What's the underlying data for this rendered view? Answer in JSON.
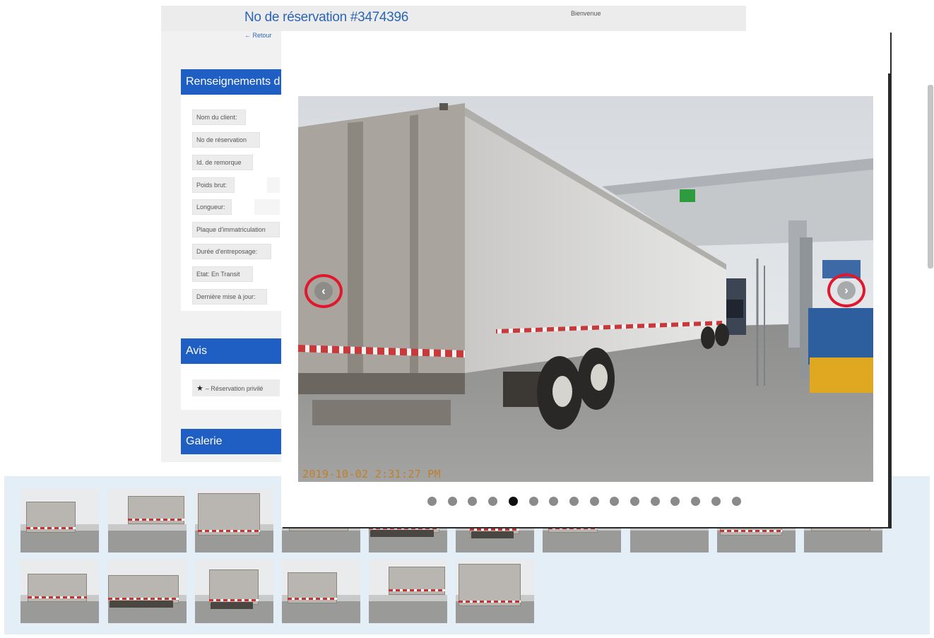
{
  "header": {
    "title": "No de réservation #3474396",
    "back_link": "← Retour",
    "welcome": "Bienvenue"
  },
  "sections": {
    "info_header": "Renseignements d",
    "reviews_header": "Avis",
    "gallery_header": "Galerie"
  },
  "info_labels": [
    "Nom du client:",
    "No de réservation",
    "Id. de remorque",
    "Poids brut:",
    "Longueur:",
    "Plaque d'immatriculation",
    "Durée d'entreposage:",
    "Etat: En Transit",
    "Dernière mise à jour:"
  ],
  "review": {
    "text": "– Réservation privilé"
  },
  "lightbox": {
    "timestamp": "2019-10-02 2:31:27 PM",
    "prev_icon": "‹",
    "next_icon": "›",
    "slide_count": 16,
    "active_slide": 5
  },
  "icons": {
    "star": "★"
  },
  "colors": {
    "brand_blue": "#1f5ec2",
    "title_blue": "#2b65b5",
    "highlight_red": "#e0172d",
    "strip_bg": "#e3eef7"
  },
  "gallery": {
    "row1_count": 10,
    "row2_count": 6
  }
}
